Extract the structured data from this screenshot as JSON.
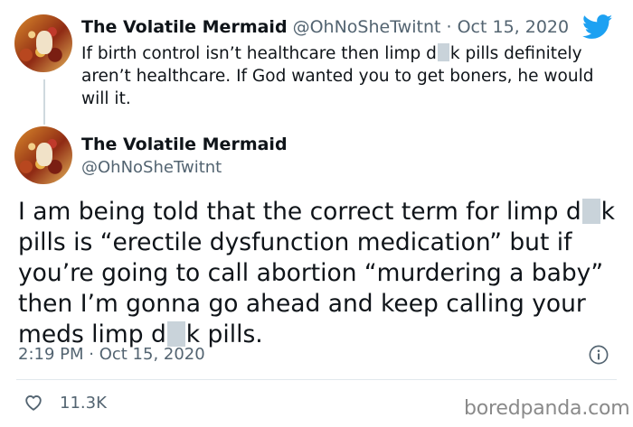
{
  "reply": {
    "display_name": "The Volatile Mermaid",
    "handle": "@OhNoSheTwitnt",
    "separator": "·",
    "date": "Oct 15, 2020",
    "text_part1": "If birth control isn’t healthcare then limp d",
    "text_part2": "k pills definitely aren’t healthcare. If God wanted you to get boners, he would will it."
  },
  "main": {
    "display_name": "The Volatile Mermaid",
    "handle": "@OhNoSheTwitnt",
    "text_part1": "I am being told that the correct term for limp d",
    "text_part2": "k pills is “erectile dysfunction medication” but if you’re going to call abortion “murdering a baby” then I’m gonna go ahead and keep calling your meds limp d",
    "text_part3": "k pills.",
    "timestamp": "2:19 PM · Oct 15, 2020",
    "likes": "11.3K"
  },
  "icons": {
    "logo": "twitter-bird-icon",
    "info": "info-icon",
    "like": "heart-icon"
  },
  "colors": {
    "twitter_blue": "#1da1f2",
    "muted_text": "#536471",
    "censor_box": "#c9d3da"
  },
  "watermark": "boredpanda.com"
}
